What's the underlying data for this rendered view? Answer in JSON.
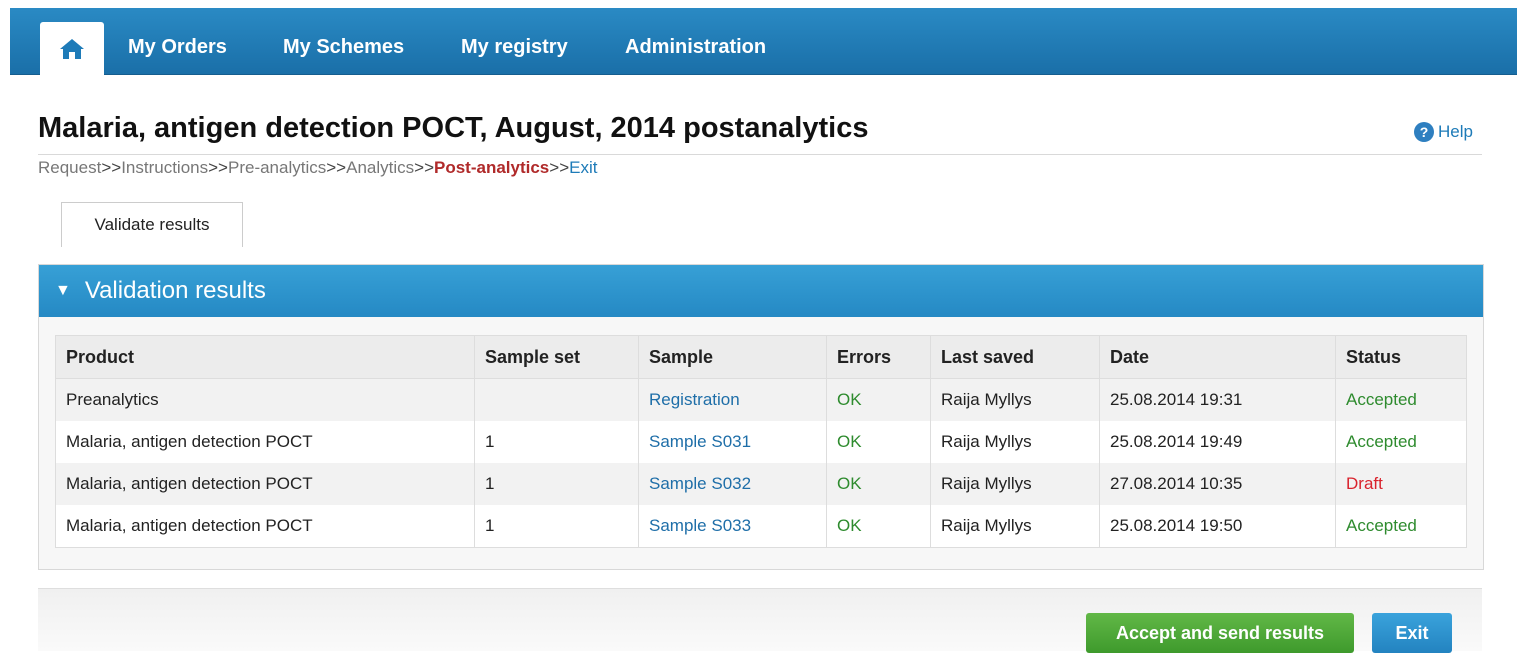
{
  "nav": {
    "home_icon": "home-icon",
    "items": [
      {
        "label": "My Orders"
      },
      {
        "label": "My Schemes"
      },
      {
        "label": "My registry"
      },
      {
        "label": "Administration"
      }
    ]
  },
  "page": {
    "title": "Malaria, antigen detection POCT, August, 2014 postanalytics",
    "help_label": "Help"
  },
  "breadcrumb": {
    "steps": [
      "Request",
      "Instructions",
      "Pre-analytics",
      "Analytics",
      "Post-analytics",
      "Exit"
    ],
    "separator": ">>"
  },
  "tab": {
    "label": "Validate results"
  },
  "panel": {
    "title": "Validation results"
  },
  "table": {
    "headers": [
      "Product",
      "Sample set",
      "Sample",
      "Errors",
      "Last saved",
      "Date",
      "Status"
    ],
    "rows": [
      {
        "product": "Preanalytics",
        "sample_set": "",
        "sample": "Registration",
        "errors": "OK",
        "last_saved": "Raija Myllys",
        "date": "25.08.2014 19:31",
        "status": "Accepted"
      },
      {
        "product": "Malaria, antigen detection POCT",
        "sample_set": "1",
        "sample": "Sample S031",
        "errors": "OK",
        "last_saved": "Raija Myllys",
        "date": "25.08.2014 19:49",
        "status": "Accepted"
      },
      {
        "product": "Malaria, antigen detection POCT",
        "sample_set": "1",
        "sample": "Sample S032",
        "errors": "OK",
        "last_saved": "Raija Myllys",
        "date": "27.08.2014 10:35",
        "status": "Draft"
      },
      {
        "product": "Malaria, antigen detection POCT",
        "sample_set": "1",
        "sample": "Sample S033",
        "errors": "OK",
        "last_saved": "Raija Myllys",
        "date": "25.08.2014 19:50",
        "status": "Accepted"
      }
    ]
  },
  "footer": {
    "accept_label": "Accept and send results",
    "exit_label": "Exit"
  },
  "colors": {
    "nav": "#1a6fa8",
    "panel_header": "#2589c4",
    "accepted": "#2e8b2e",
    "draft": "#d9232d",
    "accept_button": "#3e9a2c",
    "exit_button": "#2383c0"
  }
}
